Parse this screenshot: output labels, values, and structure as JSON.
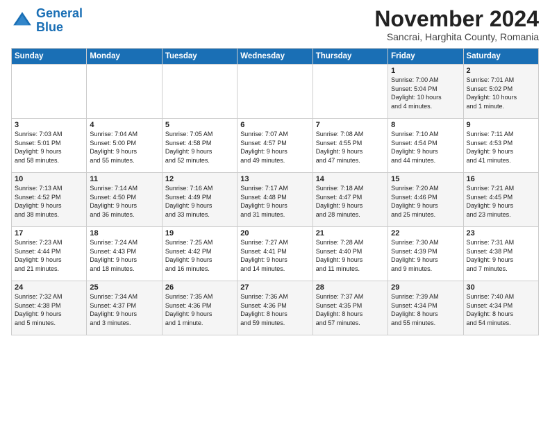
{
  "header": {
    "logo_line1": "General",
    "logo_line2": "Blue",
    "month_title": "November 2024",
    "subtitle": "Sancrai, Harghita County, Romania"
  },
  "weekdays": [
    "Sunday",
    "Monday",
    "Tuesday",
    "Wednesday",
    "Thursday",
    "Friday",
    "Saturday"
  ],
  "rows": [
    [
      {
        "day": "",
        "info": ""
      },
      {
        "day": "",
        "info": ""
      },
      {
        "day": "",
        "info": ""
      },
      {
        "day": "",
        "info": ""
      },
      {
        "day": "",
        "info": ""
      },
      {
        "day": "1",
        "info": "Sunrise: 7:00 AM\nSunset: 5:04 PM\nDaylight: 10 hours\nand 4 minutes."
      },
      {
        "day": "2",
        "info": "Sunrise: 7:01 AM\nSunset: 5:02 PM\nDaylight: 10 hours\nand 1 minute."
      }
    ],
    [
      {
        "day": "3",
        "info": "Sunrise: 7:03 AM\nSunset: 5:01 PM\nDaylight: 9 hours\nand 58 minutes."
      },
      {
        "day": "4",
        "info": "Sunrise: 7:04 AM\nSunset: 5:00 PM\nDaylight: 9 hours\nand 55 minutes."
      },
      {
        "day": "5",
        "info": "Sunrise: 7:05 AM\nSunset: 4:58 PM\nDaylight: 9 hours\nand 52 minutes."
      },
      {
        "day": "6",
        "info": "Sunrise: 7:07 AM\nSunset: 4:57 PM\nDaylight: 9 hours\nand 49 minutes."
      },
      {
        "day": "7",
        "info": "Sunrise: 7:08 AM\nSunset: 4:55 PM\nDaylight: 9 hours\nand 47 minutes."
      },
      {
        "day": "8",
        "info": "Sunrise: 7:10 AM\nSunset: 4:54 PM\nDaylight: 9 hours\nand 44 minutes."
      },
      {
        "day": "9",
        "info": "Sunrise: 7:11 AM\nSunset: 4:53 PM\nDaylight: 9 hours\nand 41 minutes."
      }
    ],
    [
      {
        "day": "10",
        "info": "Sunrise: 7:13 AM\nSunset: 4:52 PM\nDaylight: 9 hours\nand 38 minutes."
      },
      {
        "day": "11",
        "info": "Sunrise: 7:14 AM\nSunset: 4:50 PM\nDaylight: 9 hours\nand 36 minutes."
      },
      {
        "day": "12",
        "info": "Sunrise: 7:16 AM\nSunset: 4:49 PM\nDaylight: 9 hours\nand 33 minutes."
      },
      {
        "day": "13",
        "info": "Sunrise: 7:17 AM\nSunset: 4:48 PM\nDaylight: 9 hours\nand 31 minutes."
      },
      {
        "day": "14",
        "info": "Sunrise: 7:18 AM\nSunset: 4:47 PM\nDaylight: 9 hours\nand 28 minutes."
      },
      {
        "day": "15",
        "info": "Sunrise: 7:20 AM\nSunset: 4:46 PM\nDaylight: 9 hours\nand 25 minutes."
      },
      {
        "day": "16",
        "info": "Sunrise: 7:21 AM\nSunset: 4:45 PM\nDaylight: 9 hours\nand 23 minutes."
      }
    ],
    [
      {
        "day": "17",
        "info": "Sunrise: 7:23 AM\nSunset: 4:44 PM\nDaylight: 9 hours\nand 21 minutes."
      },
      {
        "day": "18",
        "info": "Sunrise: 7:24 AM\nSunset: 4:43 PM\nDaylight: 9 hours\nand 18 minutes."
      },
      {
        "day": "19",
        "info": "Sunrise: 7:25 AM\nSunset: 4:42 PM\nDaylight: 9 hours\nand 16 minutes."
      },
      {
        "day": "20",
        "info": "Sunrise: 7:27 AM\nSunset: 4:41 PM\nDaylight: 9 hours\nand 14 minutes."
      },
      {
        "day": "21",
        "info": "Sunrise: 7:28 AM\nSunset: 4:40 PM\nDaylight: 9 hours\nand 11 minutes."
      },
      {
        "day": "22",
        "info": "Sunrise: 7:30 AM\nSunset: 4:39 PM\nDaylight: 9 hours\nand 9 minutes."
      },
      {
        "day": "23",
        "info": "Sunrise: 7:31 AM\nSunset: 4:38 PM\nDaylight: 9 hours\nand 7 minutes."
      }
    ],
    [
      {
        "day": "24",
        "info": "Sunrise: 7:32 AM\nSunset: 4:38 PM\nDaylight: 9 hours\nand 5 minutes."
      },
      {
        "day": "25",
        "info": "Sunrise: 7:34 AM\nSunset: 4:37 PM\nDaylight: 9 hours\nand 3 minutes."
      },
      {
        "day": "26",
        "info": "Sunrise: 7:35 AM\nSunset: 4:36 PM\nDaylight: 9 hours\nand 1 minute."
      },
      {
        "day": "27",
        "info": "Sunrise: 7:36 AM\nSunset: 4:36 PM\nDaylight: 8 hours\nand 59 minutes."
      },
      {
        "day": "28",
        "info": "Sunrise: 7:37 AM\nSunset: 4:35 PM\nDaylight: 8 hours\nand 57 minutes."
      },
      {
        "day": "29",
        "info": "Sunrise: 7:39 AM\nSunset: 4:34 PM\nDaylight: 8 hours\nand 55 minutes."
      },
      {
        "day": "30",
        "info": "Sunrise: 7:40 AM\nSunset: 4:34 PM\nDaylight: 8 hours\nand 54 minutes."
      }
    ]
  ]
}
